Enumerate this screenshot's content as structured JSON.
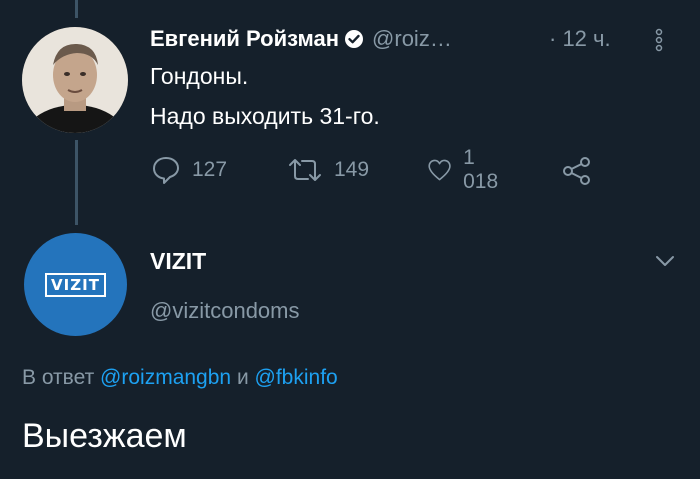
{
  "tweet1": {
    "name": "Евгений Ройзман",
    "handle": "@roiz…",
    "time": "· 12 ч.",
    "lines": [
      "Гондоны.",
      "Надо выходить 31-го."
    ],
    "replies": "127",
    "retweets": "149",
    "likes": "1 018"
  },
  "tweet2": {
    "name": "VIZIT",
    "handle": "@vizitcondoms",
    "logo_text": "VIZIT",
    "reply_prefix": "В ответ",
    "mention1": "@roizmangbn",
    "conj": "и",
    "mention2": "@fbkinfo",
    "text": "Выезжаем"
  },
  "colors": {
    "background": "#15202b",
    "muted": "#8899a6",
    "link": "#1da1f2",
    "vizit_avatar": "#2474bc"
  },
  "icons": [
    "verified-icon",
    "more-vertical-icon",
    "reply-icon",
    "retweet-icon",
    "like-icon",
    "share-icon",
    "chevron-down-icon"
  ]
}
